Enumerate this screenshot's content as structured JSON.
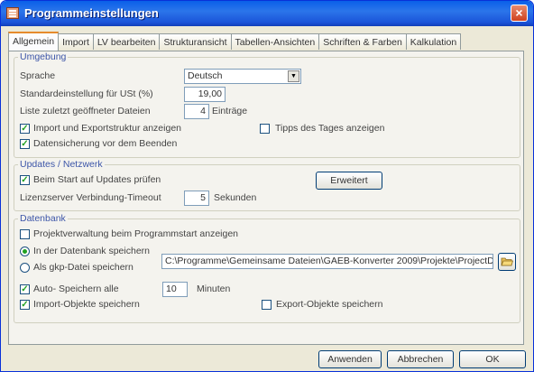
{
  "window": {
    "title": "Programmeinstellungen",
    "close_symbol": "×"
  },
  "tabs": [
    "Allgemein",
    "Import",
    "LV bearbeiten",
    "Strukturansicht",
    "Tabellen-Ansichten",
    "Schriften & Farben",
    "Kalkulation"
  ],
  "umgebung": {
    "legend": "Umgebung",
    "sprache_label": "Sprache",
    "sprache_value": "Deutsch",
    "ust_label": "Standardeinstellung für USt (%)",
    "ust_value": "19,00",
    "liste_label": "Liste zuletzt geöffneter Dateien",
    "liste_value": "4",
    "liste_suffix": "Einträge",
    "import_export_label": "Import und Exportstruktur anzeigen",
    "import_export_checked": true,
    "tipps_label": "Tipps des Tages anzeigen",
    "tipps_checked": false,
    "datensicherung_label": "Datensicherung vor dem Beenden",
    "datensicherung_checked": true
  },
  "updates": {
    "legend": "Updates / Netzwerk",
    "start_label": "Beim Start auf Updates prüfen",
    "start_checked": true,
    "erweitert_label": "Erweitert",
    "timeout_label": "Lizenzserver Verbindung-Timeout",
    "timeout_value": "5",
    "timeout_suffix": "Sekunden"
  },
  "datenbank": {
    "legend": "Datenbank",
    "projektverwaltung_label": "Projektverwaltung beim Programmstart anzeigen",
    "projektverwaltung_checked": false,
    "in_db_label": "In der Datenbank speichern",
    "gkp_label": "Als gkp-Datei speichern",
    "path_value": "C:\\Programme\\Gemeinsame Dateien\\GAEB-Konverter 2009\\Projekte\\ProjectD",
    "autosave_label": "Auto- Speichern alle",
    "autosave_checked": true,
    "autosave_value": "10",
    "autosave_suffix": "Minuten",
    "import_objekte_label": "Import-Objekte speichern",
    "import_objekte_checked": true,
    "export_objekte_label": "Export-Objekte speichern",
    "export_objekte_checked": false
  },
  "footer": {
    "anwenden": "Anwenden",
    "abbrechen": "Abbrechen",
    "ok": "OK"
  },
  "colors": {
    "titlebar": "#2b75ea",
    "tab_highlight": "#e68b2c",
    "legend": "#3c55a8",
    "check": "#21a121"
  },
  "icons": {
    "app": "settings-app-icon",
    "close": "close-icon",
    "folder": "folder-open-icon",
    "dropdown": "chevron-down-icon"
  }
}
